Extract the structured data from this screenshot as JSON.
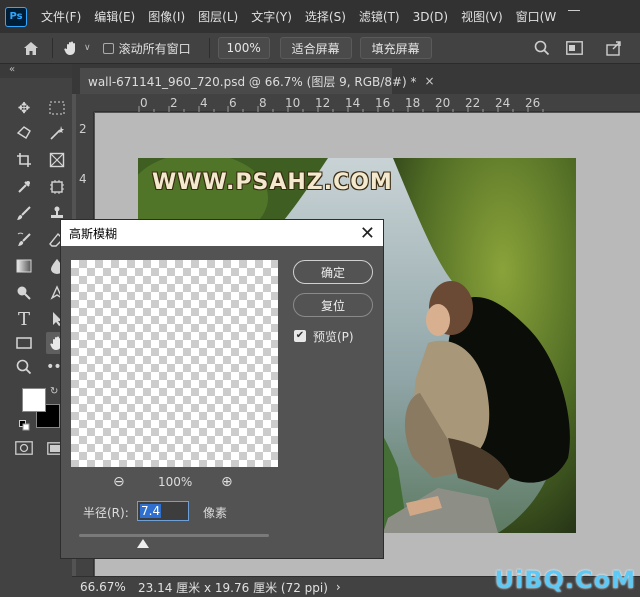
{
  "menubar": {
    "logo": "Ps",
    "items": [
      "文件(F)",
      "编辑(E)",
      "图像(I)",
      "图层(L)",
      "文字(Y)",
      "选择(S)",
      "滤镜(T)",
      "3D(D)",
      "视图(V)",
      "窗口(W"
    ]
  },
  "options": {
    "scroll_all_label": "滚动所有窗口",
    "zoom_value": "100%",
    "fit_screen": "适合屏幕",
    "fill_screen": "填充屏幕"
  },
  "tabs": {
    "collapse": "«",
    "document": "wall-671141_960_720.psd @ 66.7% (图层 9, RGB/8#) *",
    "close": "×"
  },
  "ruler": {
    "top": [
      "0",
      "2",
      "4",
      "6",
      "8",
      "10",
      "12",
      "14",
      "16",
      "18",
      "20",
      "22",
      "24",
      "26"
    ],
    "left": [
      "2",
      "4"
    ]
  },
  "photo": {
    "watermark": "WWW.PSAHZ.COM"
  },
  "dialog": {
    "title": "高斯模糊",
    "close": "✕",
    "ok": "确定",
    "reset": "复位",
    "preview_label": "预览(P)",
    "preview_checked": true,
    "zoom_out": "⊖",
    "zoom_in": "⊕",
    "zoom_level": "100%",
    "radius_label": "半径(R):",
    "radius_value": "7.4",
    "unit": "像素"
  },
  "status": {
    "zoom": "66.67%",
    "size": "23.14 厘米 x 19.76 厘米 (72 ppi)",
    "arrow": "›"
  },
  "site_watermark": "UiBQ.CoM",
  "colors": {
    "accent": "#31a8ff",
    "foreground": "#ffffff",
    "background": "#000000"
  }
}
